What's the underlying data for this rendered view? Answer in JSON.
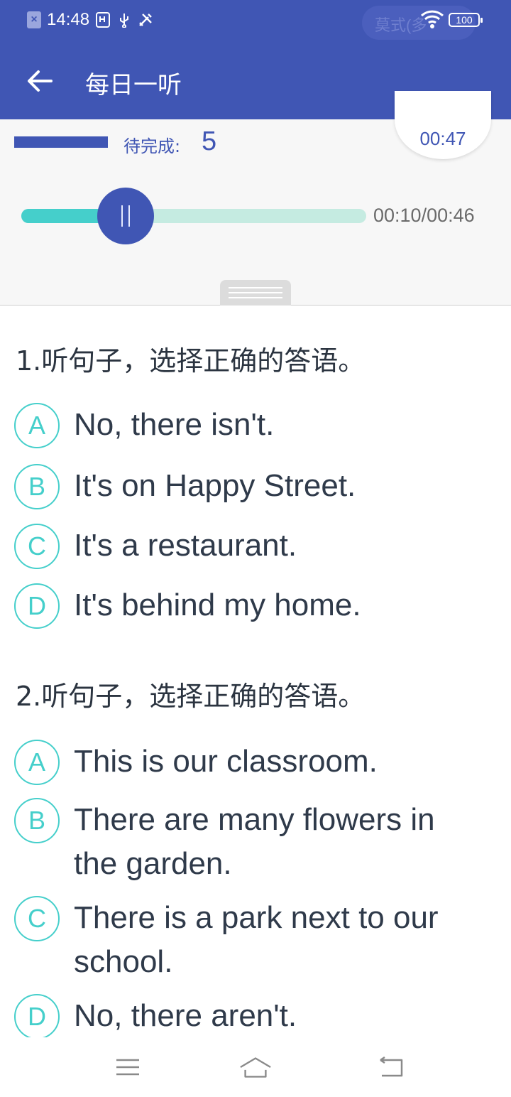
{
  "status_bar": {
    "time": "14:48",
    "notification_text": "莫式(多",
    "battery": "100"
  },
  "app_bar": {
    "title": "每日一听"
  },
  "player": {
    "pending_label": "待完成:",
    "pending_count": "5",
    "countdown": "00:47",
    "time_readout": "00:10/00:46",
    "progress_fraction": 0.22
  },
  "questions": [
    {
      "prompt": "1.听句子，选择正确的答语。",
      "options": [
        {
          "letter": "A",
          "text": "No, there isn't."
        },
        {
          "letter": "B",
          "text": "It's on Happy Street."
        },
        {
          "letter": "C",
          "text": "It's a restaurant."
        },
        {
          "letter": "D",
          "text": "It's behind my home."
        }
      ]
    },
    {
      "prompt": "2.听句子，选择正确的答语。",
      "options": [
        {
          "letter": "A",
          "text": "This is our classroom."
        },
        {
          "letter": "B",
          "text": "There are many flowers in the garden."
        },
        {
          "letter": "C",
          "text": "There is a park next to our school."
        },
        {
          "letter": "D",
          "text": "No, there aren't."
        }
      ]
    }
  ],
  "colors": {
    "primary": "#4056b4",
    "accent": "#45cfcb",
    "track": "#c5ebe1"
  }
}
